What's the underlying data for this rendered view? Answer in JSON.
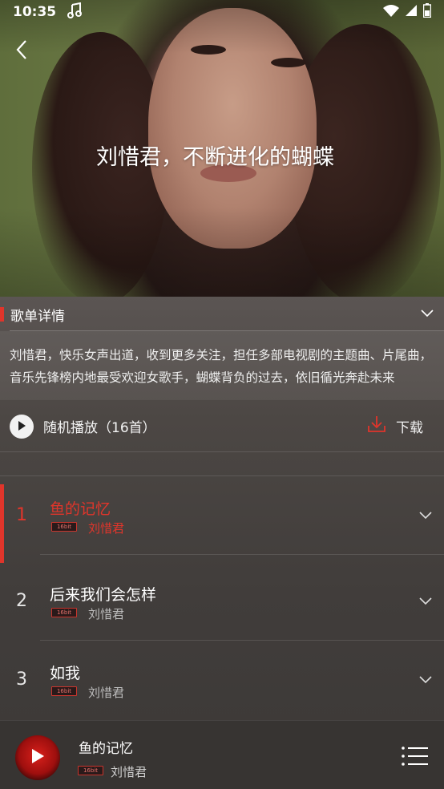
{
  "status_bar": {
    "time": "10:35"
  },
  "hero": {
    "title": "刘惜君，不断进化的蝴蝶"
  },
  "detail": {
    "header_label": "歌单详情",
    "description": "刘惜君，快乐女声出道，收到更多关注，担任多部电视剧的主题曲、片尾曲，音乐先锋榜内地最受欢迎女歌手，蝴蝶背负的过去，依旧循光奔赴未来"
  },
  "actions": {
    "shuffle_label": "随机播放（16首）",
    "download_label": "下载"
  },
  "songs": [
    {
      "index": "1",
      "title": "鱼的记忆",
      "artist": "刘惜君",
      "quality": "16bit",
      "active": true
    },
    {
      "index": "2",
      "title": "后来我们会怎样",
      "artist": "刘惜君",
      "quality": "16bit",
      "active": false
    },
    {
      "index": "3",
      "title": "如我",
      "artist": "刘惜君",
      "quality": "16bit",
      "active": false
    }
  ],
  "player": {
    "title": "鱼的记忆",
    "artist": "刘惜君",
    "quality": "16bit"
  },
  "colors": {
    "accent": "#e0352b"
  },
  "icons": [
    "music-note-icon",
    "wifi-icon",
    "signal-icon",
    "battery-icon",
    "back-arrow-icon",
    "chevron-down-icon",
    "play-icon",
    "download-icon",
    "playlist-icon"
  ]
}
